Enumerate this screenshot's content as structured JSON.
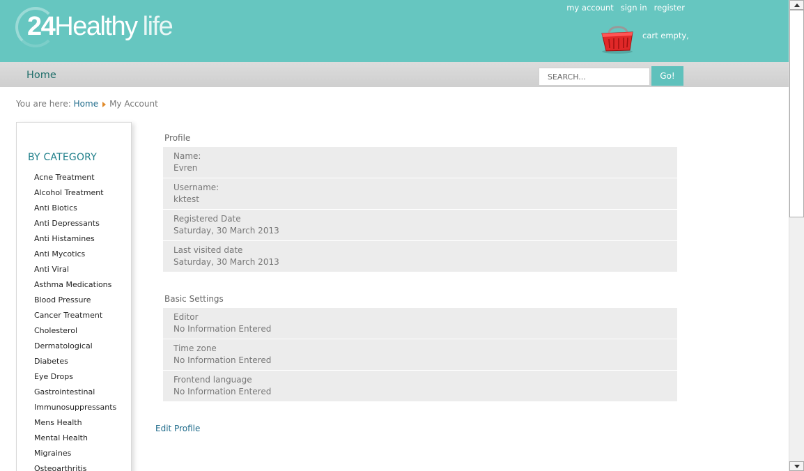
{
  "brand": {
    "number": "24",
    "word": "Healthy",
    "suffix": "life",
    "color": "#66c6c0"
  },
  "top_links": {
    "my_account": "my account",
    "sign_in": "sign in",
    "register": "register"
  },
  "cart": {
    "status": "cart empty,",
    "icon": "shopping-basket-icon"
  },
  "nav": {
    "home": "Home"
  },
  "search": {
    "placeholder": "SEARCH...",
    "button": "Go!"
  },
  "breadcrumb": {
    "prefix": "You are here:",
    "home": "Home",
    "current": "My Account"
  },
  "sidebar": {
    "title": "BY CATEGORY",
    "items": [
      "Acne Treatment",
      "Alcohol Treatment",
      "Anti Biotics",
      "Anti Depressants",
      "Anti Histamines",
      "Anti Mycotics",
      "Anti Viral",
      "Asthma Medications",
      "Blood Pressure",
      "Cancer Treatment",
      "Cholesterol",
      "Dermatological",
      "Diabetes",
      "Eye Drops",
      "Gastrointestinal",
      "Immunosuppressants",
      "Mens Health",
      "Mental Health",
      "Migraines",
      "Osteoarthritis"
    ]
  },
  "profile": {
    "title": "Profile",
    "rows": [
      {
        "label": "Name:",
        "value": "Evren"
      },
      {
        "label": "Username:",
        "value": "kktest"
      },
      {
        "label": "Registered Date",
        "value": "Saturday, 30 March 2013"
      },
      {
        "label": "Last visited date",
        "value": "Saturday, 30 March 2013"
      }
    ]
  },
  "basic_settings": {
    "title": "Basic Settings",
    "rows": [
      {
        "label": "Editor",
        "value": "No Information Entered"
      },
      {
        "label": "Time zone",
        "value": "No Information Entered"
      },
      {
        "label": "Frontend language",
        "value": "No Information Entered"
      }
    ]
  },
  "edit_profile": "Edit Profile"
}
